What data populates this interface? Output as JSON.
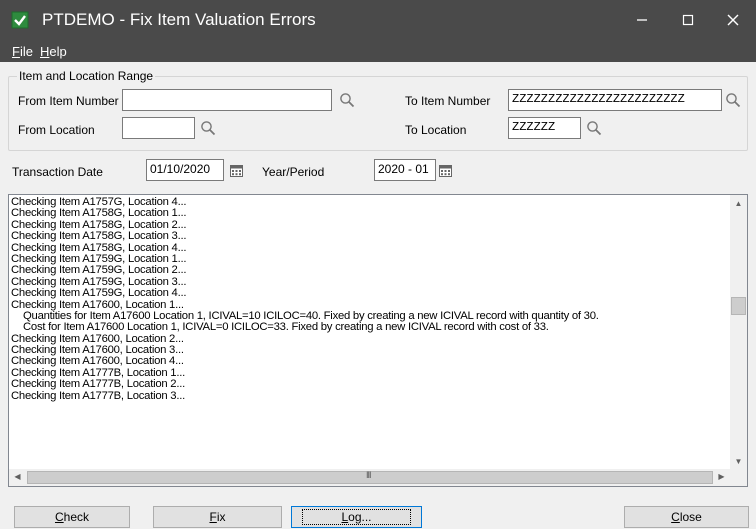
{
  "window": {
    "title": "PTDEMO - Fix Item Valuation Errors",
    "controls": {
      "minimize": "–",
      "maximize": "☐",
      "close": "✕"
    }
  },
  "menu": {
    "file": {
      "label": "File",
      "underline": "F",
      "rest": "ile"
    },
    "help": {
      "label": "Help",
      "underline": "H",
      "rest": "elp"
    }
  },
  "range": {
    "group_title": "Item and Location Range",
    "from_item_label": "From Item Number",
    "from_item_value": "",
    "to_item_label": "To Item Number",
    "to_item_value": "ZZZZZZZZZZZZZZZZZZZZZZZZ",
    "from_location_label": "From Location",
    "from_location_value": "",
    "to_location_label": "To Location",
    "to_location_value": "ZZZZZZ"
  },
  "dates": {
    "transaction_date_label": "Transaction Date",
    "transaction_date_value": "01/10/2020",
    "year_period_label": "Year/Period",
    "year_period_value": "2020 - 01"
  },
  "log": {
    "lines": [
      "Checking Item A1757G, Location 4...",
      "Checking Item A1758G, Location 1...",
      "Checking Item A1758G, Location 2...",
      "Checking Item A1758G, Location 3...",
      "Checking Item A1758G, Location 4...",
      "Checking Item A1759G, Location 1...",
      "Checking Item A1759G, Location 2...",
      "Checking Item A1759G, Location 3...",
      "Checking Item A1759G, Location 4...",
      "Checking Item A17600, Location 1...",
      "Quantities for Item A17600 Location 1, ICIVAL=10 ICILOC=40. Fixed by creating a new ICIVAL record with quantity of 30.",
      "Cost for Item A17600 Location 1, ICIVAL=0 ICILOC=33. Fixed by creating a new ICIVAL record with cost of 33.",
      "Checking Item A17600, Location 2...",
      "Checking Item A17600, Location 3...",
      "Checking Item A17600, Location 4...",
      "Checking Item A1777B, Location 1...",
      "Checking Item A1777B, Location 2...",
      "Checking Item A1777B, Location 3..."
    ],
    "scroll_grip": "III"
  },
  "buttons": {
    "check": {
      "label": "Check",
      "underline": "C",
      "rest": "heck"
    },
    "fix": {
      "label": "Fix",
      "underline": "F",
      "rest": "ix"
    },
    "log": {
      "label": "Log...",
      "underline": "L",
      "rest": "og..."
    },
    "close": {
      "label": "Close",
      "underline": "C",
      "rest": "lose"
    }
  },
  "colors": {
    "titlebar": "#4a4a4a",
    "app_icon": "#2e8b3e",
    "focus_border": "#0078d7"
  }
}
